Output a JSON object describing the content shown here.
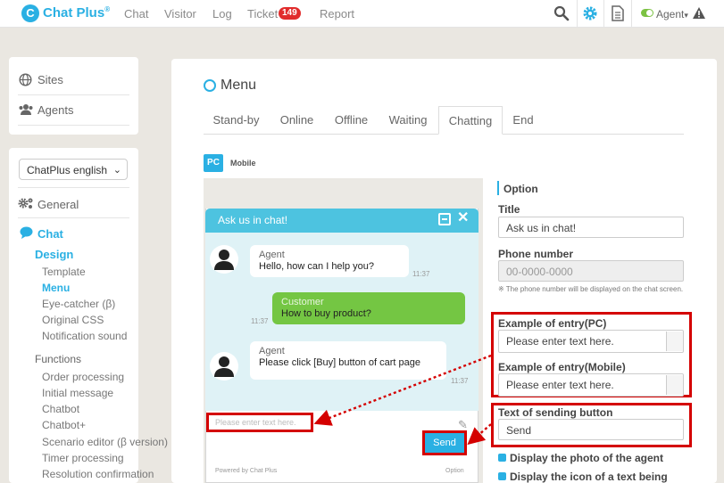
{
  "app": {
    "logo_glyph": "C",
    "logo_text": "Chat Plus"
  },
  "nav": {
    "items": [
      "Chat",
      "Visitor",
      "Log",
      "Ticket",
      "Report"
    ],
    "ticket_count": "149",
    "agent_label": "Agent"
  },
  "sidebar": {
    "sites": "Sites",
    "agents": "Agents",
    "language_select": "ChatPlus english",
    "general": "General",
    "chat": "Chat",
    "design": "Design",
    "design_items": [
      "Template",
      "Menu",
      "Eye-catcher (β)",
      "Original CSS",
      "Notification sound"
    ],
    "functions": "Functions",
    "function_items": [
      "Order processing",
      "Initial message",
      "Chatbot",
      "Chatbot+",
      "Scenario editor (β version)",
      "Timer processing",
      "Resolution confirmation"
    ]
  },
  "main": {
    "title": "Menu",
    "tabs": [
      "Stand-by",
      "Online",
      "Offline",
      "Waiting",
      "Chatting",
      "End"
    ],
    "active_tab": "Chatting",
    "device_badge": "PC",
    "device_label": "Mobile"
  },
  "preview": {
    "header_title": "Ask us in chat!",
    "messages": [
      {
        "who": "Agent",
        "text": "Hello, how can I help you?",
        "time": "11:37"
      },
      {
        "who": "Customer",
        "text": "How to buy product?",
        "time": "11:37"
      },
      {
        "who": "Agent",
        "text": "Please click [Buy] button of cart page",
        "time": "11:37"
      }
    ],
    "input_placeholder": "Please enter text here.",
    "send_label": "Send",
    "powered_by": "Powered by Chat Plus",
    "option_link": "Option"
  },
  "option": {
    "heading": "Option",
    "title_label": "Title",
    "title_value": "Ask us in chat!",
    "phone_label": "Phone number",
    "phone_placeholder": "00-0000-0000",
    "phone_note": "※ The phone number will be displayed on the chat screen.",
    "entry_pc_label": "Example of entry(PC)",
    "entry_pc_value": "Please enter text here.",
    "entry_mobile_label": "Example of entry(Mobile)",
    "entry_mobile_value": "Please enter text here.",
    "send_button_label": "Text of sending button",
    "send_button_value": "Send",
    "display_photo": "Display the photo of the agent",
    "display_icon": "Display the icon of a text being"
  },
  "colors": {
    "accent": "#2ab0e3",
    "header": "#4dc3e0",
    "customer": "#74c643",
    "highlight": "#d40000",
    "badge": "#e12c2c"
  }
}
